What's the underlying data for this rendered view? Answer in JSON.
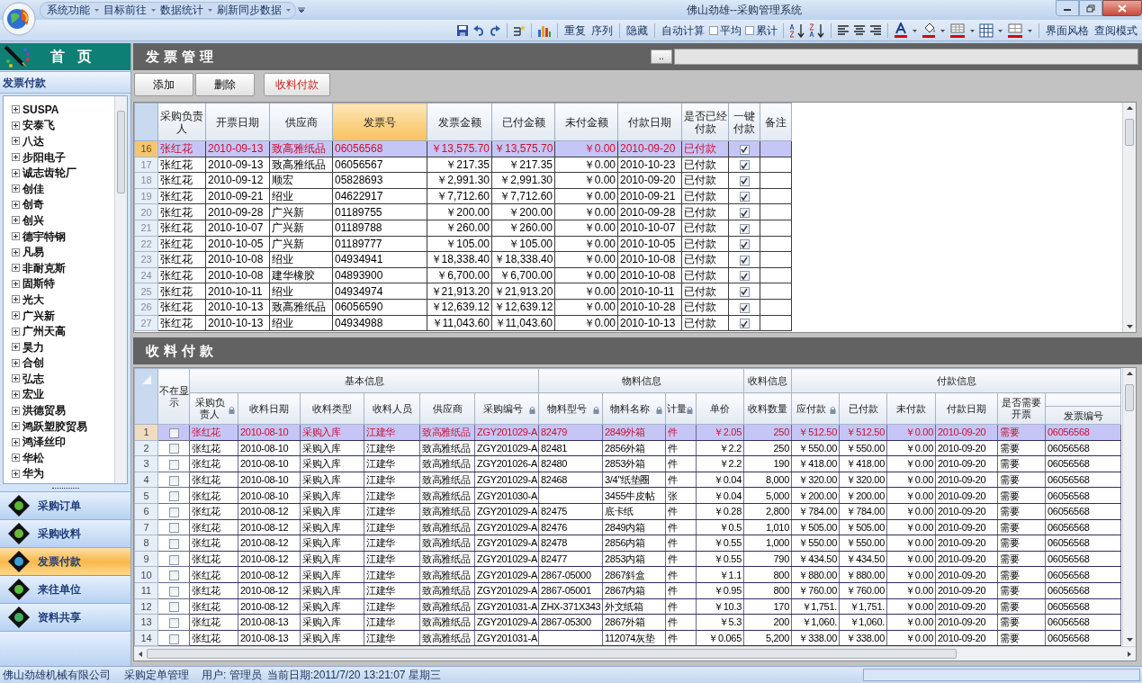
{
  "app": {
    "title": "佛山劲雄--采购管理系统",
    "menu": [
      "系统功能",
      "目标前往",
      "数据统计",
      "刷新同步数据"
    ]
  },
  "toolbar": {
    "commands": [
      {
        "kind": "button",
        "label": "重复"
      },
      {
        "kind": "button",
        "label": "序列"
      },
      {
        "kind": "button",
        "label": "隐藏"
      },
      {
        "kind": "button",
        "label": "自动计算"
      },
      {
        "kind": "checkbox",
        "label": "平均",
        "checked": false
      },
      {
        "kind": "checkbox",
        "label": "累计",
        "checked": false
      },
      {
        "kind": "button",
        "label": "界面风格"
      },
      {
        "kind": "button",
        "label": "查阅模式"
      }
    ]
  },
  "sidebar": {
    "title": "首页",
    "section": "发票付款",
    "tree": [
      {
        "label": "SUSPA",
        "expanded": false
      },
      {
        "label": "安泰飞",
        "expanded": false
      },
      {
        "label": "八达",
        "expanded": false
      },
      {
        "label": "步阳电子",
        "expanded": false
      },
      {
        "label": "诚志齿轮厂",
        "expanded": false
      },
      {
        "label": "创佳",
        "expanded": false
      },
      {
        "label": "创奇",
        "expanded": false
      },
      {
        "label": "创兴",
        "expanded": false
      },
      {
        "label": "德宇特钢",
        "expanded": false
      },
      {
        "label": "凡易",
        "expanded": false
      },
      {
        "label": "非耐克斯",
        "expanded": false
      },
      {
        "label": "固斯特",
        "expanded": false
      },
      {
        "label": "光大",
        "expanded": false
      },
      {
        "label": "广兴新",
        "expanded": false
      },
      {
        "label": "广州天高",
        "expanded": false
      },
      {
        "label": "昊力",
        "expanded": false
      },
      {
        "label": "合创",
        "expanded": false
      },
      {
        "label": "弘志",
        "expanded": false
      },
      {
        "label": "宏业",
        "expanded": false
      },
      {
        "label": "洪德贸易",
        "expanded": false
      },
      {
        "label": "鸿跃塑胶贸易",
        "expanded": false
      },
      {
        "label": "鸿泽丝印",
        "expanded": false
      },
      {
        "label": "华松",
        "expanded": false
      },
      {
        "label": "华为",
        "expanded": false
      }
    ],
    "nav": [
      {
        "label": "采购订单",
        "selected": false
      },
      {
        "label": "采购收料",
        "selected": false
      },
      {
        "label": "发票付款",
        "selected": true
      },
      {
        "label": "来往单位",
        "selected": false
      },
      {
        "label": "资料共享",
        "selected": false
      }
    ]
  },
  "invoice_panel": {
    "title": "发票管理",
    "path_button": "..",
    "buttons": [
      {
        "label": "添加",
        "kind": "normal"
      },
      {
        "label": "删除",
        "kind": "normal"
      },
      {
        "label": "收料付款",
        "kind": "highlight"
      }
    ],
    "table": {
      "columns": [
        {
          "label": "采购负责人",
          "selected": false
        },
        {
          "label": "开票日期",
          "selected": false
        },
        {
          "label": "供应商",
          "selected": false
        },
        {
          "label": "发票号",
          "selected": true
        },
        {
          "label": "发票金额",
          "selected": false
        },
        {
          "label": "已付金额",
          "selected": false
        },
        {
          "label": "未付金额",
          "selected": false
        },
        {
          "label": "付款日期",
          "selected": false
        },
        {
          "label": "是否已经付款",
          "selected": false
        },
        {
          "label": "一键付款",
          "selected": false
        },
        {
          "label": "备注",
          "selected": false
        }
      ],
      "rows": [
        {
          "number": "16",
          "selected": true,
          "paid": true,
          "cells": [
            "张红花",
            "2010-09-13",
            "致高雅纸品",
            "06056568",
            "￥13,575.70",
            "￥13,575.70",
            "￥0.00",
            "2010-09-20",
            "已付款"
          ]
        },
        {
          "number": "17",
          "selected": false,
          "paid": true,
          "cells": [
            "张红花",
            "2010-09-13",
            "致高雅纸品",
            "06056567",
            "￥217.35",
            "￥217.35",
            "￥0.00",
            "2010-10-23",
            "已付款"
          ]
        },
        {
          "number": "18",
          "selected": false,
          "paid": true,
          "cells": [
            "张红花",
            "2010-09-12",
            "顺宏",
            "05828693",
            "￥2,991.30",
            "￥2,991.30",
            "￥0.00",
            "2010-09-20",
            "已付款"
          ]
        },
        {
          "number": "19",
          "selected": false,
          "paid": true,
          "cells": [
            "张红花",
            "2010-09-21",
            "绍业",
            "04622917",
            "￥7,712.60",
            "￥7,712.60",
            "￥0.00",
            "2010-09-21",
            "已付款"
          ]
        },
        {
          "number": "20",
          "selected": false,
          "paid": true,
          "cells": [
            "张红花",
            "2010-09-28",
            "广兴新",
            "01189755",
            "￥200.00",
            "￥200.00",
            "￥0.00",
            "2010-09-28",
            "已付款"
          ]
        },
        {
          "number": "21",
          "selected": false,
          "paid": true,
          "cells": [
            "张红花",
            "2010-10-07",
            "广兴新",
            "01189788",
            "￥260.00",
            "￥260.00",
            "￥0.00",
            "2010-10-07",
            "已付款"
          ]
        },
        {
          "number": "22",
          "selected": false,
          "paid": true,
          "cells": [
            "张红花",
            "2010-10-05",
            "广兴新",
            "01189777",
            "￥105.00",
            "￥105.00",
            "￥0.00",
            "2010-10-05",
            "已付款"
          ]
        },
        {
          "number": "23",
          "selected": false,
          "paid": true,
          "cells": [
            "张红花",
            "2010-10-08",
            "绍业",
            "04934941",
            "￥18,338.40",
            "￥18,338.40",
            "￥0.00",
            "2010-10-08",
            "已付款"
          ]
        },
        {
          "number": "24",
          "selected": false,
          "paid": true,
          "cells": [
            "张红花",
            "2010-10-08",
            "建华橡胶",
            "04893900",
            "￥6,700.00",
            "￥6,700.00",
            "￥0.00",
            "2010-10-08",
            "已付款"
          ]
        },
        {
          "number": "25",
          "selected": false,
          "paid": true,
          "cells": [
            "张红花",
            "2010-10-11",
            "绍业",
            "04934974",
            "￥21,913.20",
            "￥21,913.20",
            "￥0.00",
            "2010-10-11",
            "已付款"
          ]
        },
        {
          "number": "26",
          "selected": false,
          "paid": true,
          "cells": [
            "张红花",
            "2010-10-13",
            "致高雅纸品",
            "06056590",
            "￥12,639.12",
            "￥12,639.12",
            "￥0.00",
            "2010-10-28",
            "已付款"
          ]
        },
        {
          "number": "27",
          "selected": false,
          "paid": true,
          "cells": [
            "张红花",
            "2010-10-13",
            "绍业",
            "04934988",
            "￥11,043.60",
            "￥11,043.60",
            "￥0.00",
            "2010-10-13",
            "已付款"
          ]
        }
      ]
    }
  },
  "receipt_panel": {
    "title": "收料付款",
    "table": {
      "lead_column": {
        "label": "不在显示"
      },
      "groups": [
        {
          "label": "基本信息",
          "columns": [
            {
              "label": "采购负责人",
              "locked": true
            },
            {
              "label": "收料日期",
              "locked": false
            },
            {
              "label": "收料类型",
              "locked": false
            },
            {
              "label": "收料人员",
              "locked": false
            },
            {
              "label": "供应商",
              "locked": false
            },
            {
              "label": "采购编号",
              "locked": true
            }
          ]
        },
        {
          "label": "物料信息",
          "columns": [
            {
              "label": "物料型号",
              "locked": true
            },
            {
              "label": "物料名称",
              "locked": true
            },
            {
              "label": "计量",
              "locked": true
            },
            {
              "label": "单价",
              "locked": false
            }
          ]
        },
        {
          "label": "收料信息",
          "columns": [
            {
              "label": "收料数量",
              "locked": false
            }
          ]
        },
        {
          "label": "付款信息",
          "columns": [
            {
              "label": "应付款",
              "locked": true
            },
            {
              "label": "已付款",
              "locked": false
            },
            {
              "label": "未付款",
              "locked": false
            },
            {
              "label": "付款日期",
              "locked": false
            },
            {
              "label": "是否需要开票",
              "locked": false
            },
            {
              "label": "发票编号",
              "locked": false
            }
          ]
        }
      ],
      "rows": [
        {
          "number": "1",
          "selected": true,
          "hidden": false,
          "cells": [
            "张红花",
            "2010-08-10",
            "采购入库",
            "江建华",
            "致高雅纸品",
            "ZGY201029-A",
            "82479",
            "2849外箱",
            "件",
            "￥2.05",
            "250",
            "￥512.50",
            "￥512.50",
            "￥0.00",
            "2010-09-20",
            "需要",
            "06056568"
          ]
        },
        {
          "number": "2",
          "selected": false,
          "hidden": false,
          "cells": [
            "张红花",
            "2010-08-10",
            "采购入库",
            "江建华",
            "致高雅纸品",
            "ZGY201029-A",
            "82481",
            "2856外箱",
            "件",
            "￥2.2",
            "250",
            "￥550.00",
            "￥550.00",
            "￥0.00",
            "2010-09-20",
            "需要",
            "06056568"
          ]
        },
        {
          "number": "3",
          "selected": false,
          "hidden": false,
          "cells": [
            "张红花",
            "2010-08-10",
            "采购入库",
            "江建华",
            "致高雅纸品",
            "ZGY201026-A",
            "82480",
            "2853外箱",
            "件",
            "￥2.2",
            "190",
            "￥418.00",
            "￥418.00",
            "￥0.00",
            "2010-09-20",
            "需要",
            "06056568"
          ]
        },
        {
          "number": "4",
          "selected": false,
          "hidden": false,
          "cells": [
            "张红花",
            "2010-08-10",
            "采购入库",
            "江建华",
            "致高雅纸品",
            "ZGY201029-A",
            "82468",
            "3/4\"纸垫圈",
            "件",
            "￥0.04",
            "8,000",
            "￥320.00",
            "￥320.00",
            "￥0.00",
            "2010-09-20",
            "需要",
            "06056568"
          ]
        },
        {
          "number": "5",
          "selected": false,
          "hidden": false,
          "cells": [
            "张红花",
            "2010-08-10",
            "采购入库",
            "江建华",
            "致高雅纸品",
            "ZGY201030-A",
            null,
            "3455牛皮帖",
            "张",
            "￥0.04",
            "5,000",
            "￥200.00",
            "￥200.00",
            "￥0.00",
            "2010-09-20",
            "需要",
            "06056568"
          ]
        },
        {
          "number": "6",
          "selected": false,
          "hidden": false,
          "cells": [
            "张红花",
            "2010-08-12",
            "采购入库",
            "江建华",
            "致高雅纸品",
            "ZGY201029-A",
            "82475",
            "底卡纸",
            "件",
            "￥0.28",
            "2,800",
            "￥784.00",
            "￥784.00",
            "￥0.00",
            "2010-09-20",
            "需要",
            "06056568"
          ]
        },
        {
          "number": "7",
          "selected": false,
          "hidden": false,
          "cells": [
            "张红花",
            "2010-08-12",
            "采购入库",
            "江建华",
            "致高雅纸品",
            "ZGY201029-A",
            "82476",
            "2849内箱",
            "件",
            "￥0.5",
            "1,010",
            "￥505.00",
            "￥505.00",
            "￥0.00",
            "2010-09-20",
            "需要",
            "06056568"
          ]
        },
        {
          "number": "8",
          "selected": false,
          "hidden": false,
          "cells": [
            "张红花",
            "2010-08-12",
            "采购入库",
            "江建华",
            "致高雅纸品",
            "ZGY201029-A",
            "82478",
            "2856内箱",
            "件",
            "￥0.55",
            "1,000",
            "￥550.00",
            "￥550.00",
            "￥0.00",
            "2010-09-20",
            "需要",
            "06056568"
          ]
        },
        {
          "number": "9",
          "selected": false,
          "hidden": false,
          "cells": [
            "张红花",
            "2010-08-12",
            "采购入库",
            "江建华",
            "致高雅纸品",
            "ZGY201029-A",
            "82477",
            "2853内箱",
            "件",
            "￥0.55",
            "790",
            "￥434.50",
            "￥434.50",
            "￥0.00",
            "2010-09-20",
            "需要",
            "06056568"
          ]
        },
        {
          "number": "10",
          "selected": false,
          "hidden": false,
          "cells": [
            "张红花",
            "2010-08-12",
            "采购入库",
            "江建华",
            "致高雅纸品",
            "ZGY201029-A",
            "2867-05000",
            "2867斜盒",
            "件",
            "￥1.1",
            "800",
            "￥880.00",
            "￥880.00",
            "￥0.00",
            "2010-09-20",
            "需要",
            "06056568"
          ]
        },
        {
          "number": "11",
          "selected": false,
          "hidden": false,
          "cells": [
            "张红花",
            "2010-08-12",
            "采购入库",
            "江建华",
            "致高雅纸品",
            "ZGY201029-A",
            "2867-05001",
            "2867内箱",
            "件",
            "￥0.95",
            "800",
            "￥760.00",
            "￥760.00",
            "￥0.00",
            "2010-09-20",
            "需要",
            "06056568"
          ]
        },
        {
          "number": "12",
          "selected": false,
          "hidden": false,
          "cells": [
            "张红花",
            "2010-08-12",
            "采购入库",
            "江建华",
            "致高雅纸品",
            "ZGY201031-A",
            "ZHX-371X343",
            "外文纸箱",
            "件",
            "￥10.3",
            "170",
            "￥1,751.",
            "￥1,751.",
            "￥0.00",
            "2010-09-20",
            "需要",
            "06056568"
          ]
        },
        {
          "number": "13",
          "selected": false,
          "hidden": false,
          "cells": [
            "张红花",
            "2010-08-13",
            "采购入库",
            "江建华",
            "致高雅纸品",
            "ZGY201029-A",
            "2867-05300",
            "2867外箱",
            "件",
            "￥5.3",
            "200",
            "￥1,060.",
            "￥1,060.",
            "￥0.00",
            "2010-09-20",
            "需要",
            "06056568"
          ]
        },
        {
          "number": "14",
          "selected": false,
          "hidden": false,
          "cells": [
            "张红花",
            "2010-08-13",
            "采购入库",
            "江建华",
            "致高雅纸品",
            "ZGY201031-A",
            null,
            "112074灰垫",
            "件",
            "￥0.065",
            "5,200",
            "￥338.00",
            "￥338.00",
            "￥0.00",
            "2010-09-20",
            "需要",
            "06056568"
          ]
        }
      ]
    }
  },
  "status_bar": {
    "company": "佛山劲雄机械有限公司",
    "module": "采购定单管理",
    "user": "用户: 管理员",
    "date": "当前日期:2011/7/20 13:21:07 星期三"
  }
}
